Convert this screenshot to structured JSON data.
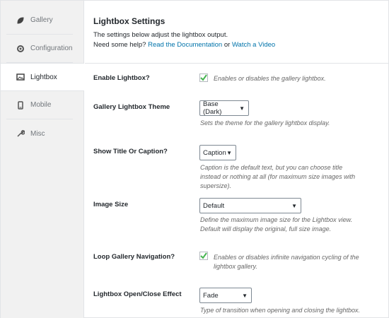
{
  "sidebar": {
    "items": [
      {
        "label": "Gallery",
        "icon": "leaf-icon"
      },
      {
        "label": "Configuration",
        "icon": "gear-icon"
      },
      {
        "label": "Lightbox",
        "icon": "image-icon"
      },
      {
        "label": "Mobile",
        "icon": "mobile-icon"
      },
      {
        "label": "Misc",
        "icon": "wrench-icon"
      }
    ],
    "active": "Lightbox"
  },
  "header": {
    "title": "Lightbox Settings",
    "desc_line1": "The settings below adjust the lightbox output.",
    "help_prefix": "Need some help?",
    "doc_link": "Read the Documentation",
    "or_text": "or",
    "video_link": "Watch a Video"
  },
  "settings": {
    "enable": {
      "label": "Enable Lightbox?",
      "checked": true,
      "help": "Enables or disables the gallery lightbox."
    },
    "theme": {
      "label": "Gallery Lightbox Theme",
      "value": "Base (Dark)",
      "help": "Sets the theme for the gallery lightbox display."
    },
    "caption": {
      "label": "Show Title Or Caption?",
      "value": "Caption",
      "help": "Caption is the default text, but you can choose title instead or nothing at all (for maximum size images with supersize)."
    },
    "size": {
      "label": "Image Size",
      "value": "Default",
      "help": "Define the maximum image size for the Lightbox view. Default will display the original, full size image."
    },
    "loop": {
      "label": "Loop Gallery Navigation?",
      "checked": true,
      "help": "Enables or disables infinite navigation cycling of the lightbox gallery."
    },
    "effect": {
      "label": "Lightbox Open/Close Effect",
      "value": "Fade",
      "help": "Type of transition when opening and closing the lightbox."
    }
  },
  "colors": {
    "accent": "#0073aa",
    "check": "#46b450"
  }
}
